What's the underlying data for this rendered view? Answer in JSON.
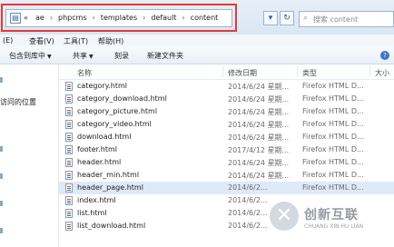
{
  "address": {
    "crumbs": [
      "ae",
      "phpcms",
      "templates",
      "default",
      "content"
    ],
    "prefix_chevron": "«",
    "separator": "›",
    "dropdown_glyph": "▾",
    "refresh_glyph": "↻"
  },
  "search": {
    "placeholder": "搜索 content"
  },
  "menu": {
    "items": [
      "(E)",
      "查看(V)",
      "工具(T)",
      "帮助(H)"
    ]
  },
  "toolbar": {
    "include": "包含到库中",
    "share": "共享",
    "burn": "刻录",
    "new_folder": "新建文件夹",
    "help_glyph": "?"
  },
  "nav": {
    "recent": "访问的位置"
  },
  "columns": {
    "name": "名称",
    "date": "修改日期",
    "type": "类型",
    "size": "大小"
  },
  "files": [
    {
      "name": "category.html",
      "date": "2014/6/24 星期...",
      "type": "Firefox HTML D..."
    },
    {
      "name": "category_download.html",
      "date": "2014/6/24 星期...",
      "type": "Firefox HTML D..."
    },
    {
      "name": "category_picture.html",
      "date": "2014/6/24 星期...",
      "type": "Firefox HTML D..."
    },
    {
      "name": "category_video.html",
      "date": "2014/6/24 星期...",
      "type": "Firefox HTML D..."
    },
    {
      "name": "download.html",
      "date": "2014/6/24 星期...",
      "type": "Firefox HTML D..."
    },
    {
      "name": "footer.html",
      "date": "2017/4/12 星期...",
      "type": "Firefox HTML D..."
    },
    {
      "name": "header.html",
      "date": "2014/6/24 星期...",
      "type": "Firefox HTML D..."
    },
    {
      "name": "header_min.html",
      "date": "2014/6/24 星期...",
      "type": "Firefox HTML D..."
    },
    {
      "name": "header_page.html",
      "date": "2014/6/2...",
      "type": "Firefox HTML D...",
      "selected": true
    },
    {
      "name": "index.html",
      "date": "2014/6/2...",
      "type": ""
    },
    {
      "name": "list.html",
      "date": "2014/6/2...",
      "type": ""
    },
    {
      "name": "list_download.html",
      "date": "2014/6/2...",
      "type": ""
    }
  ],
  "watermark": {
    "cn": "创新互联",
    "en": "CHUANG XIN HU LIAN"
  },
  "colors": {
    "highlight_frame": "#e53935",
    "selection": "#dfeaf8"
  }
}
